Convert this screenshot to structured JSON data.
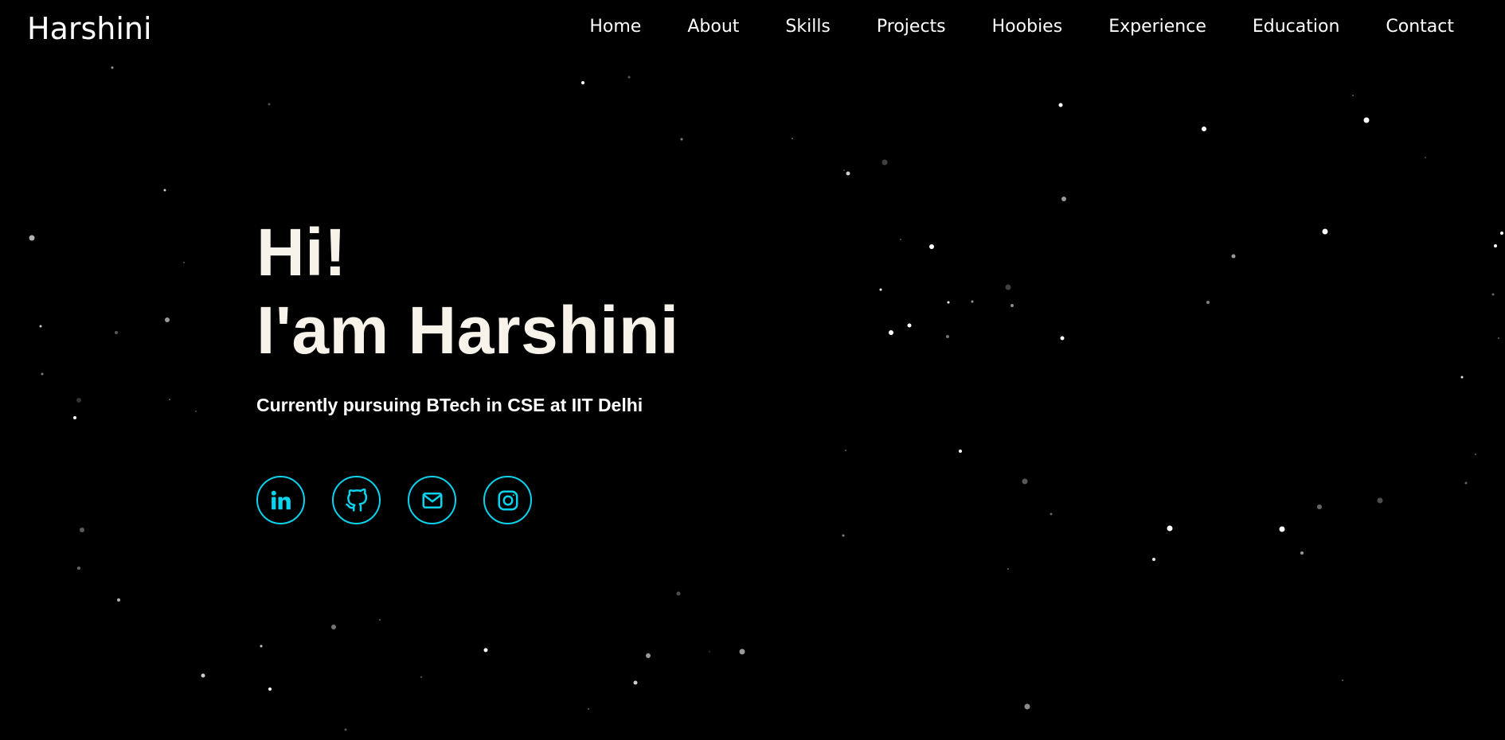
{
  "header": {
    "brand": "Harshini"
  },
  "nav": {
    "items": [
      {
        "label": "Home"
      },
      {
        "label": "About"
      },
      {
        "label": "Skills"
      },
      {
        "label": "Projects"
      },
      {
        "label": "Hoobies"
      },
      {
        "label": "Experience"
      },
      {
        "label": "Education"
      },
      {
        "label": "Contact"
      }
    ]
  },
  "hero": {
    "greeting": "Hi!",
    "name_line": "I'am Harshini",
    "subtitle": "Currently pursuing BTech in CSE at IIT Delhi"
  },
  "socials": [
    {
      "icon": "linkedin-icon"
    },
    {
      "icon": "github-icon"
    },
    {
      "icon": "mail-icon"
    },
    {
      "icon": "instagram-icon"
    }
  ],
  "colors": {
    "background": "#000000",
    "accent": "#0ad3ee",
    "heading": "#f7f2ea",
    "text": "#ffffff"
  }
}
